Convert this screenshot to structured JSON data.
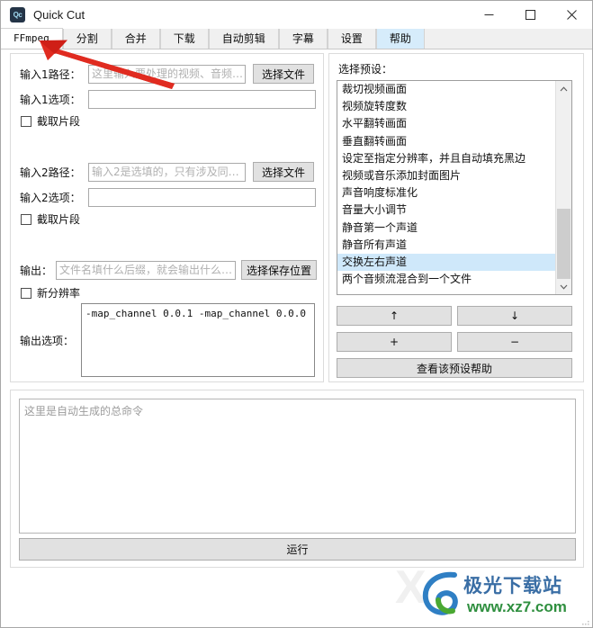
{
  "window": {
    "title": "Quick Cut",
    "icon_label": "Qc",
    "minimize_label": "minimize",
    "maximize_label": "maximize",
    "close_label": "close"
  },
  "tabs": [
    {
      "label": "FFmpeg",
      "state": "active"
    },
    {
      "label": "分割",
      "state": "normal"
    },
    {
      "label": "合并",
      "state": "normal"
    },
    {
      "label": "下载",
      "state": "normal"
    },
    {
      "label": "自动剪辑",
      "state": "normal"
    },
    {
      "label": "字幕",
      "state": "normal"
    },
    {
      "label": "设置",
      "state": "normal"
    },
    {
      "label": "帮助",
      "state": "hot"
    }
  ],
  "left_panel": {
    "input1_path_label": "输入1路径：",
    "input1_path_placeholder": "这里输入要处理的视频、音频…",
    "input1_path_value": "",
    "input1_browse_label": "选择文件",
    "input1_options_label": "输入1选项：",
    "input1_options_value": "",
    "input1_clip_checkbox_label": "截取片段",
    "input1_clip_checked": false,
    "input2_path_label": "输入2路径：",
    "input2_path_placeholder": "输入2是选填的，只有涉及同…",
    "input2_path_value": "",
    "input2_browse_label": "选择文件",
    "input2_options_label": "输入2选项：",
    "input2_options_value": "",
    "input2_clip_checkbox_label": "截取片段",
    "input2_clip_checked": false,
    "output_label": "输出：",
    "output_placeholder": "文件名填什么后缀，就会输出什么…",
    "output_value": "",
    "output_browse_label": "选择保存位置",
    "new_resolution_checkbox_label": "新分辨率",
    "new_resolution_checked": false,
    "output_options_label": "输出选项：",
    "output_options_value": "-map_channel 0.0.1 -map_channel 0.0.0"
  },
  "right_panel": {
    "preset_section_label": "选择预设：",
    "preset_items": [
      "裁切视频画面",
      "视频旋转度数",
      "水平翻转画面",
      "垂直翻转画面",
      "设定至指定分辨率，并且自动填充黑边",
      "视频或音乐添加封面图片",
      "声音响度标准化",
      "音量大小调节",
      "静音第一个声道",
      "静音所有声道",
      "交换左右声道",
      "两个音频流混合到一个文件"
    ],
    "selected_preset": "交换左右声道",
    "selected_index": 10,
    "move_up_label": "↑",
    "move_down_label": "↓",
    "add_label": "+",
    "remove_label": "−",
    "preset_help_label": "查看该预设帮助",
    "scrollbar_up_icon": "chevron-up-icon",
    "scrollbar_down_icon": "chevron-down-icon"
  },
  "command_panel": {
    "command_placeholder": "这里是自动生成的总命令",
    "command_value": "",
    "run_label": "运行"
  },
  "annotation": {
    "arrow_color": "#e02b20",
    "points_to": "FFmpeg tab"
  },
  "watermark": {
    "brand": "极光下载站",
    "url": "www.xz7.com",
    "mark": "X"
  },
  "colors": {
    "accent_selection": "#cfe8fa",
    "tab_hot": "#d6ecfb",
    "button_face": "#e1e1e1",
    "window_border": "#a8a8a8",
    "placeholder_text": "#b0b0b0"
  }
}
